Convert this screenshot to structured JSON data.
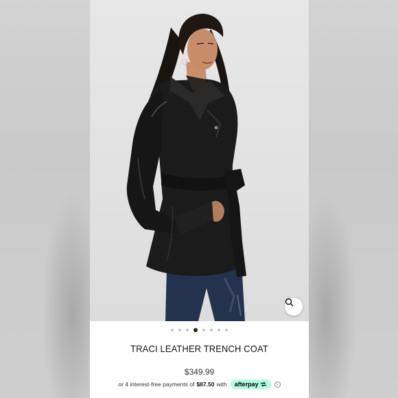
{
  "product": {
    "title": "TRACI LEATHER TRENCH COAT",
    "price": "$349.99",
    "installments_prefix": "or 4 interest-free payments of",
    "installment_amount": "$87.50",
    "installments_suffix": "with",
    "afterpay_label": "afterpay"
  },
  "gallery": {
    "image_count": 8,
    "active_index": 3,
    "zoom_icon": "magnifier-icon",
    "info_icon": "info-icon"
  },
  "colors": {
    "afterpay_mint": "#b2fce4",
    "coat": "#1b1b1b",
    "jeans": "#25324f",
    "background": "#e4e4e4"
  }
}
